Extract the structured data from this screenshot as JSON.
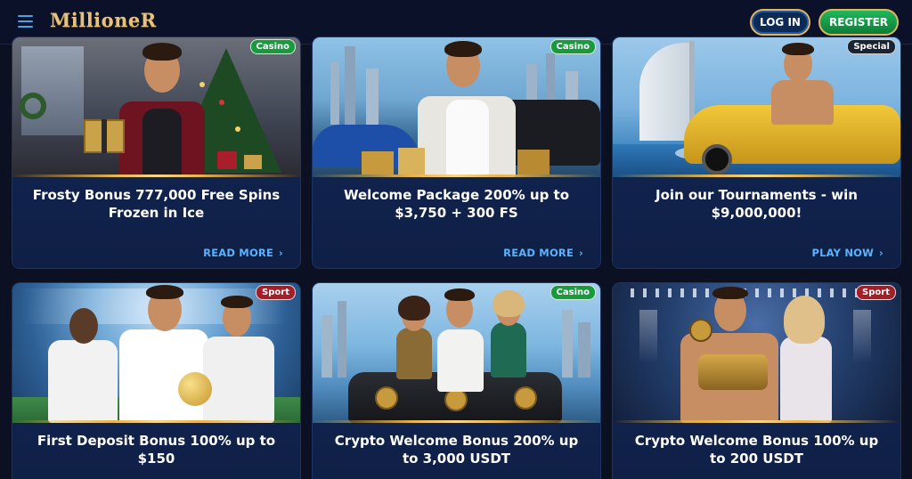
{
  "header": {
    "logo": "MillioneR",
    "login_label": "LOG IN",
    "register_label": "REGISTER"
  },
  "cards": [
    {
      "badge": "Casino",
      "title": "Frosty Bonus 777,000 Free Spins Frozen in Ice",
      "link": "READ MORE"
    },
    {
      "badge": "Casino",
      "title": "Welcome Package 200% up to $3,750 + 300 FS",
      "link": "READ MORE"
    },
    {
      "badge": "Special",
      "title": "Join our Tournaments - win $9,000,000!",
      "link": "PLAY NOW"
    },
    {
      "badge": "Sport",
      "title": "First Deposit Bonus 100% up to $150",
      "link": ""
    },
    {
      "badge": "Casino",
      "title": "Crypto Welcome Bonus 200% up to 3,000 USDT",
      "link": ""
    },
    {
      "badge": "Sport",
      "title": "Crypto Welcome Bonus 100% up to 200 USDT",
      "link": ""
    }
  ],
  "colors": {
    "background": "#0b1022",
    "accent_gold": "#e0b75e",
    "link_blue": "#59b3ff",
    "casino_badge": "#1a9a3f",
    "sport_badge": "#a41e2a",
    "special_badge": "#1a2433"
  },
  "icons": {
    "menu": "hamburger-icon",
    "link_arrow": "chevron-right-icon"
  }
}
